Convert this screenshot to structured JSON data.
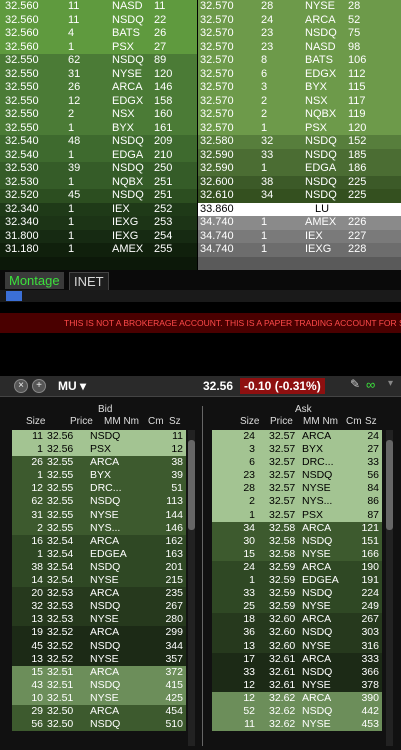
{
  "top_left": [
    {
      "price": "32.560",
      "size": "11",
      "mm": "NASD",
      "id": "11",
      "bg": "#5f9a3e"
    },
    {
      "price": "32.560",
      "size": "11",
      "mm": "NSDQ",
      "id": "22",
      "bg": "#5f9a3e"
    },
    {
      "price": "32.560",
      "size": "4",
      "mm": "BATS",
      "id": "26",
      "bg": "#5f9a3e"
    },
    {
      "price": "32.560",
      "size": "1",
      "mm": "PSX",
      "id": "27",
      "bg": "#5f9a3e"
    },
    {
      "price": "32.550",
      "size": "62",
      "mm": "NSDQ",
      "id": "89",
      "bg": "#4b7b36"
    },
    {
      "price": "32.550",
      "size": "31",
      "mm": "NYSE",
      "id": "120",
      "bg": "#4b7b36"
    },
    {
      "price": "32.550",
      "size": "26",
      "mm": "ARCA",
      "id": "146",
      "bg": "#4b7b36"
    },
    {
      "price": "32.550",
      "size": "12",
      "mm": "EDGX",
      "id": "158",
      "bg": "#4b7b36"
    },
    {
      "price": "32.550",
      "size": "2",
      "mm": "NSX",
      "id": "160",
      "bg": "#4b7b36"
    },
    {
      "price": "32.550",
      "size": "1",
      "mm": "BYX",
      "id": "161",
      "bg": "#4b7b36"
    },
    {
      "price": "32.540",
      "size": "48",
      "mm": "NSDQ",
      "id": "209",
      "bg": "#3e6a2e"
    },
    {
      "price": "32.540",
      "size": "1",
      "mm": "EDGA",
      "id": "210",
      "bg": "#3e6a2e"
    },
    {
      "price": "32.530",
      "size": "39",
      "mm": "NSDQ",
      "id": "250",
      "bg": "#355c28"
    },
    {
      "price": "32.530",
      "size": "1",
      "mm": "NQBX",
      "id": "251",
      "bg": "#355c28"
    },
    {
      "price": "32.520",
      "size": "45",
      "mm": "NSDQ",
      "id": "251",
      "bg": "#2c4e20"
    },
    {
      "price": "32.340",
      "size": "1",
      "mm": "IEX",
      "id": "252",
      "bg": "#1f3a18"
    },
    {
      "price": "32.340",
      "size": "1",
      "mm": "IEXG",
      "id": "253",
      "bg": "#1c3416"
    },
    {
      "price": "31.800",
      "size": "1",
      "mm": "IEXG",
      "id": "254",
      "bg": "#162a12"
    },
    {
      "price": "31.180",
      "size": "1",
      "mm": "AMEX",
      "id": "255",
      "bg": "#10200c"
    },
    {
      "price": "",
      "size": "",
      "mm": "",
      "id": "",
      "bg": "#0c1809"
    }
  ],
  "top_right": [
    {
      "price": "32.570",
      "size": "28",
      "mm": "NYSE",
      "id": "28",
      "bg": "#6d9a4a"
    },
    {
      "price": "32.570",
      "size": "24",
      "mm": "ARCA",
      "id": "52",
      "bg": "#6d9a4a"
    },
    {
      "price": "32.570",
      "size": "23",
      "mm": "NSDQ",
      "id": "75",
      "bg": "#6d9a4a"
    },
    {
      "price": "32.570",
      "size": "23",
      "mm": "NASD",
      "id": "98",
      "bg": "#6d9a4a"
    },
    {
      "price": "32.570",
      "size": "8",
      "mm": "BATS",
      "id": "106",
      "bg": "#6d9a4a"
    },
    {
      "price": "32.570",
      "size": "6",
      "mm": "EDGX",
      "id": "112",
      "bg": "#6d9a4a"
    },
    {
      "price": "32.570",
      "size": "3",
      "mm": "BYX",
      "id": "115",
      "bg": "#6d9a4a"
    },
    {
      "price": "32.570",
      "size": "2",
      "mm": "NSX",
      "id": "117",
      "bg": "#6d9a4a"
    },
    {
      "price": "32.570",
      "size": "2",
      "mm": "NQBX",
      "id": "119",
      "bg": "#6d9a4a"
    },
    {
      "price": "32.570",
      "size": "1",
      "mm": "PSX",
      "id": "120",
      "bg": "#6d9a4a"
    },
    {
      "price": "32.580",
      "size": "32",
      "mm": "NSDQ",
      "id": "152",
      "bg": "#577e3c"
    },
    {
      "price": "32.590",
      "size": "33",
      "mm": "NSDQ",
      "id": "185",
      "bg": "#4b6d33"
    },
    {
      "price": "32.590",
      "size": "1",
      "mm": "EDGA",
      "id": "186",
      "bg": "#4b6d33"
    },
    {
      "price": "32.600",
      "size": "38",
      "mm": "NSDQ",
      "id": "225",
      "bg": "#3c5a28"
    },
    {
      "price": "32.610",
      "size": "34",
      "mm": "NSDQ",
      "id": "225",
      "bg": "#34501f"
    },
    {
      "price": "33.860",
      "size": "",
      "mm": "LU",
      "id": "",
      "bg": "#ffffff"
    },
    {
      "price": "34.740",
      "size": "1",
      "mm": "AMEX",
      "id": "226",
      "bg": "#8a8a8a"
    },
    {
      "price": "34.740",
      "size": "1",
      "mm": "IEX",
      "id": "227",
      "bg": "#7a7a7a"
    },
    {
      "price": "34.740",
      "size": "1",
      "mm": "IEXG",
      "id": "228",
      "bg": "#6d6d6d"
    },
    {
      "price": "",
      "size": "",
      "mm": "",
      "id": "",
      "bg": "#5a5a5a"
    }
  ],
  "tabs": {
    "montage": "Montage",
    "inet": "INET"
  },
  "banner_text": "THIS IS NOT A BROKERAGE ACCOUNT. THIS IS A PAPER TRADING ACCOUNT FOR SIMULATED TRADING.",
  "quote": {
    "symbol": "MU",
    "last": "32.56",
    "change": "-0.10",
    "change_pct": "(-0.31%)",
    "change_color": "#ff6b6b"
  },
  "book": {
    "bid_title": "Bid",
    "ask_title": "Ask",
    "cols": {
      "size": "Size",
      "price": "Price",
      "mm": "MM Nm",
      "cm": "Cm",
      "sz": "Sz"
    },
    "bids": [
      {
        "size": "11",
        "price": "32.56",
        "mm": "NSDQ",
        "sz": "11",
        "bg": "#a3c492",
        "fg": "#000"
      },
      {
        "size": "1",
        "price": "32.56",
        "mm": "PSX",
        "sz": "12",
        "bg": "#a3c492",
        "fg": "#000"
      },
      {
        "size": "26",
        "price": "32.55",
        "mm": "ARCA",
        "sz": "38",
        "bg": "#3d5a2e",
        "fg": "#fff"
      },
      {
        "size": "1",
        "price": "32.55",
        "mm": "BYX",
        "sz": "39",
        "bg": "#3d5a2e",
        "fg": "#fff"
      },
      {
        "size": "12",
        "price": "32.55",
        "mm": "DRC...",
        "sz": "51",
        "bg": "#3d5a2e",
        "fg": "#fff"
      },
      {
        "size": "62",
        "price": "32.55",
        "mm": "NSDQ",
        "sz": "113",
        "bg": "#3d5a2e",
        "fg": "#fff"
      },
      {
        "size": "31",
        "price": "32.55",
        "mm": "NYSE",
        "sz": "144",
        "bg": "#3d5a2e",
        "fg": "#fff"
      },
      {
        "size": "2",
        "price": "32.55",
        "mm": "NYS...",
        "sz": "146",
        "bg": "#3d5a2e",
        "fg": "#fff"
      },
      {
        "size": "16",
        "price": "32.54",
        "mm": "ARCA",
        "sz": "162",
        "bg": "#2f4824",
        "fg": "#fff"
      },
      {
        "size": "1",
        "price": "32.54",
        "mm": "EDGEA",
        "sz": "163",
        "bg": "#2f4824",
        "fg": "#fff"
      },
      {
        "size": "38",
        "price": "32.54",
        "mm": "NSDQ",
        "sz": "201",
        "bg": "#2f4824",
        "fg": "#fff"
      },
      {
        "size": "14",
        "price": "32.54",
        "mm": "NYSE",
        "sz": "215",
        "bg": "#2f4824",
        "fg": "#fff"
      },
      {
        "size": "20",
        "price": "32.53",
        "mm": "ARCA",
        "sz": "235",
        "bg": "#26391d",
        "fg": "#fff"
      },
      {
        "size": "32",
        "price": "32.53",
        "mm": "NSDQ",
        "sz": "267",
        "bg": "#26391d",
        "fg": "#fff"
      },
      {
        "size": "13",
        "price": "32.53",
        "mm": "NYSE",
        "sz": "280",
        "bg": "#26391d",
        "fg": "#fff"
      },
      {
        "size": "19",
        "price": "32.52",
        "mm": "ARCA",
        "sz": "299",
        "bg": "#1c2a16",
        "fg": "#fff"
      },
      {
        "size": "45",
        "price": "32.52",
        "mm": "NSDQ",
        "sz": "344",
        "bg": "#1c2a16",
        "fg": "#fff"
      },
      {
        "size": "13",
        "price": "32.52",
        "mm": "NYSE",
        "sz": "357",
        "bg": "#1c2a16",
        "fg": "#fff"
      },
      {
        "size": "15",
        "price": "32.51",
        "mm": "ARCA",
        "sz": "372",
        "bg": "#6c8e5a",
        "fg": "#fff"
      },
      {
        "size": "43",
        "price": "32.51",
        "mm": "NSDQ",
        "sz": "415",
        "bg": "#6c8e5a",
        "fg": "#fff"
      },
      {
        "size": "10",
        "price": "32.51",
        "mm": "NYSE",
        "sz": "425",
        "bg": "#6c8e5a",
        "fg": "#fff"
      },
      {
        "size": "29",
        "price": "32.50",
        "mm": "ARCA",
        "sz": "454",
        "bg": "#3d5a2e",
        "fg": "#fff"
      },
      {
        "size": "56",
        "price": "32.50",
        "mm": "NSDQ",
        "sz": "510",
        "bg": "#3d5a2e",
        "fg": "#fff"
      }
    ],
    "asks": [
      {
        "size": "24",
        "price": "32.57",
        "mm": "ARCA",
        "sz": "24",
        "bg": "#a3c492",
        "fg": "#000"
      },
      {
        "size": "3",
        "price": "32.57",
        "mm": "BYX",
        "sz": "27",
        "bg": "#a3c492",
        "fg": "#000"
      },
      {
        "size": "6",
        "price": "32.57",
        "mm": "DRC...",
        "sz": "33",
        "bg": "#a3c492",
        "fg": "#000"
      },
      {
        "size": "23",
        "price": "32.57",
        "mm": "NSDQ",
        "sz": "56",
        "bg": "#a3c492",
        "fg": "#000"
      },
      {
        "size": "28",
        "price": "32.57",
        "mm": "NYSE",
        "sz": "84",
        "bg": "#a3c492",
        "fg": "#000"
      },
      {
        "size": "2",
        "price": "32.57",
        "mm": "NYS...",
        "sz": "86",
        "bg": "#a3c492",
        "fg": "#000"
      },
      {
        "size": "1",
        "price": "32.57",
        "mm": "PSX",
        "sz": "87",
        "bg": "#a3c492",
        "fg": "#000"
      },
      {
        "size": "34",
        "price": "32.58",
        "mm": "ARCA",
        "sz": "121",
        "bg": "#3d5a2e",
        "fg": "#fff"
      },
      {
        "size": "30",
        "price": "32.58",
        "mm": "NSDQ",
        "sz": "151",
        "bg": "#3d5a2e",
        "fg": "#fff"
      },
      {
        "size": "15",
        "price": "32.58",
        "mm": "NYSE",
        "sz": "166",
        "bg": "#3d5a2e",
        "fg": "#fff"
      },
      {
        "size": "24",
        "price": "32.59",
        "mm": "ARCA",
        "sz": "190",
        "bg": "#2f4824",
        "fg": "#fff"
      },
      {
        "size": "1",
        "price": "32.59",
        "mm": "EDGEA",
        "sz": "191",
        "bg": "#2f4824",
        "fg": "#fff"
      },
      {
        "size": "33",
        "price": "32.59",
        "mm": "NSDQ",
        "sz": "224",
        "bg": "#2f4824",
        "fg": "#fff"
      },
      {
        "size": "25",
        "price": "32.59",
        "mm": "NYSE",
        "sz": "249",
        "bg": "#2f4824",
        "fg": "#fff"
      },
      {
        "size": "18",
        "price": "32.60",
        "mm": "ARCA",
        "sz": "267",
        "bg": "#26391d",
        "fg": "#fff"
      },
      {
        "size": "36",
        "price": "32.60",
        "mm": "NSDQ",
        "sz": "303",
        "bg": "#26391d",
        "fg": "#fff"
      },
      {
        "size": "13",
        "price": "32.60",
        "mm": "NYSE",
        "sz": "316",
        "bg": "#26391d",
        "fg": "#fff"
      },
      {
        "size": "17",
        "price": "32.61",
        "mm": "ARCA",
        "sz": "333",
        "bg": "#1c2a16",
        "fg": "#fff"
      },
      {
        "size": "33",
        "price": "32.61",
        "mm": "NSDQ",
        "sz": "366",
        "bg": "#1c2a16",
        "fg": "#fff"
      },
      {
        "size": "12",
        "price": "32.61",
        "mm": "NYSE",
        "sz": "378",
        "bg": "#1c2a16",
        "fg": "#fff"
      },
      {
        "size": "12",
        "price": "32.62",
        "mm": "ARCA",
        "sz": "390",
        "bg": "#6c8e5a",
        "fg": "#fff"
      },
      {
        "size": "52",
        "price": "32.62",
        "mm": "NSDQ",
        "sz": "442",
        "bg": "#6c8e5a",
        "fg": "#fff"
      },
      {
        "size": "11",
        "price": "32.62",
        "mm": "NYSE",
        "sz": "453",
        "bg": "#6c8e5a",
        "fg": "#fff"
      }
    ]
  }
}
